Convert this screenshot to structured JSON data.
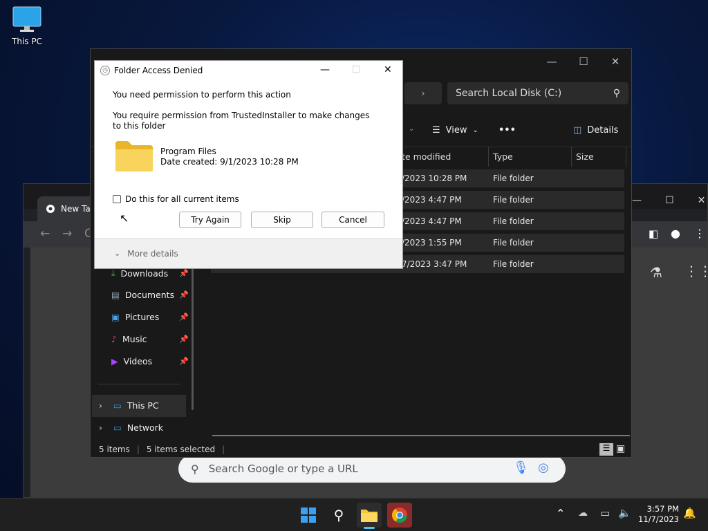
{
  "desktop": {
    "icon_label": "This PC"
  },
  "chrome": {
    "tab_label": "New Tab",
    "omnibox_placeholder": "Search Google or type a URL"
  },
  "explorer": {
    "search_placeholder": "Search Local Disk (C:)",
    "cmd": {
      "view": "View",
      "more": "•••",
      "details": "Details"
    },
    "columns": {
      "date": "te modified",
      "type": "Type",
      "size": "Size"
    },
    "rows": [
      {
        "date": "/2023 10:28 PM",
        "type": "File folder"
      },
      {
        "date": "/2023 4:47 PM",
        "type": "File folder"
      },
      {
        "date": "/2023 4:47 PM",
        "type": "File folder"
      },
      {
        "date": "/2023 1:55 PM",
        "type": "File folder"
      },
      {
        "date": "7/2023 3:47 PM",
        "type": "File folder"
      }
    ],
    "nav": {
      "downloads": "Downloads",
      "documents": "Documents",
      "pictures": "Pictures",
      "music": "Music",
      "videos": "Videos",
      "this_pc": "This PC",
      "network": "Network"
    },
    "status": {
      "items": "5 items",
      "selected": "5 items selected"
    }
  },
  "dialog": {
    "title": "Folder Access Denied",
    "heading": "You need permission to perform this action",
    "message": "You require permission from TrustedInstaller to make changes to this folder",
    "folder_name": "Program Files",
    "folder_date": "Date created: 9/1/2023 10:28 PM",
    "checkbox_label": "Do this for all current items",
    "btn_try": "Try Again",
    "btn_skip": "Skip",
    "btn_cancel": "Cancel",
    "more_details": "More details"
  },
  "taskbar": {
    "time": "3:57 PM",
    "date": "11/7/2023"
  },
  "colors": {
    "accent": "#0078d4",
    "folder": "#f4c542"
  }
}
